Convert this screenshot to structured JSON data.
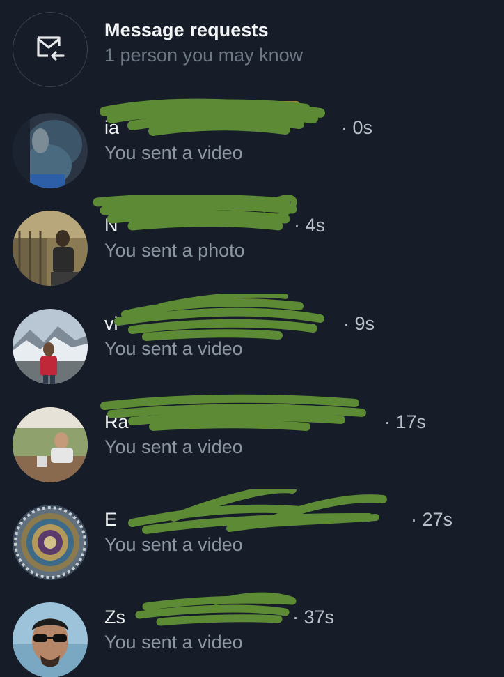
{
  "requests": {
    "title": "Message requests",
    "subtitle": "1 person you may know",
    "icon": "envelope-arrow-icon"
  },
  "conversations": [
    {
      "name_visible": "ia",
      "time": "· 0s",
      "preview": "You sent a video"
    },
    {
      "name_visible": "N",
      "time": "· 4s",
      "preview": "You sent a photo"
    },
    {
      "name_visible": "vi",
      "time": "· 9s",
      "preview": "You sent a video"
    },
    {
      "name_visible": "Ra",
      "time": "· 17s",
      "preview": "You sent a video"
    },
    {
      "name_visible": "E",
      "time": "· 27s",
      "preview": "You sent a video"
    },
    {
      "name_visible": "Zs",
      "time": "· 37s",
      "preview": "You sent a video"
    }
  ],
  "colors": {
    "background": "#161c28",
    "redaction": "#5d8a35"
  }
}
